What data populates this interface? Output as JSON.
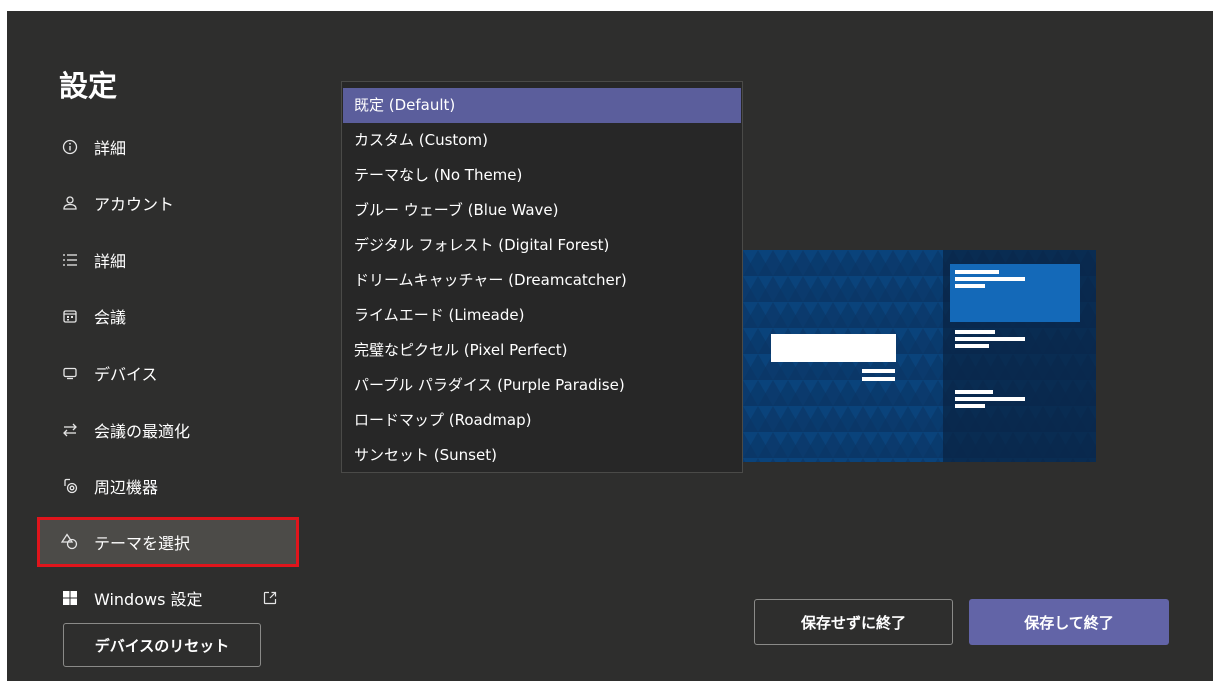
{
  "settings": {
    "title": "設定"
  },
  "nav": {
    "items": [
      {
        "label": "詳細",
        "icon": "info-icon"
      },
      {
        "label": "アカウント",
        "icon": "person-icon"
      },
      {
        "label": "詳細",
        "icon": "list-icon"
      },
      {
        "label": "会議",
        "icon": "calendar-icon"
      },
      {
        "label": "デバイス",
        "icon": "monitor-icon"
      },
      {
        "label": "会議の最適化",
        "icon": "arrows-swap-icon"
      },
      {
        "label": "周辺機器",
        "icon": "peripherals-icon"
      },
      {
        "label": "テーマを選択",
        "icon": "shapes-icon"
      },
      {
        "label": "Windows 設定",
        "icon": "windows-logo-icon"
      }
    ],
    "selected_index": 7,
    "external_link_icon": "external-link-icon"
  },
  "reset_button": {
    "label": "デバイスのリセット"
  },
  "theme_dropdown": {
    "options": [
      "既定 (Default)",
      "カスタム (Custom)",
      "テーマなし (No Theme)",
      "ブルー ウェーブ (Blue Wave)",
      "デジタル フォレスト (Digital Forest)",
      "ドリームキャッチャー (Dreamcatcher)",
      "ライムエード (Limeade)",
      "完璧なピクセル (Pixel Perfect)",
      "パープル パラダイス (Purple Paradise)",
      "ロードマップ (Roadmap)",
      "サンセット (Sunset)"
    ],
    "highlighted_index": 0
  },
  "footer": {
    "cancel_label": "保存せずに終了",
    "save_label": "保存して終了"
  },
  "colors": {
    "background": "#2e2e2d",
    "accent": "#6264a7",
    "highlight": "#5b5e9c",
    "selection_outline": "#e0151c",
    "preview_blue": "#0a4f8f"
  }
}
